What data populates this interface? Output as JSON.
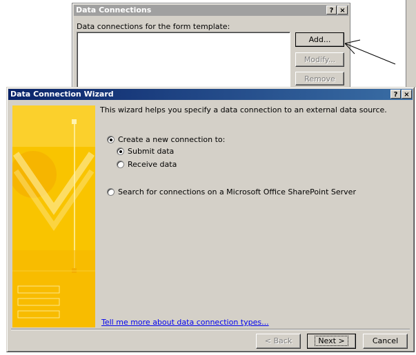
{
  "data_connections_dialog": {
    "title": "Data Connections",
    "help_button": "?",
    "close_button": "×",
    "list_label": "Data connections for the form template:",
    "buttons": {
      "add": "Add...",
      "modify": "Modify...",
      "remove": "Remove"
    }
  },
  "wizard": {
    "title": "Data Connection Wizard",
    "help_button": "?",
    "close_button": "×",
    "intro": "This wizard helps you specify a data connection to an external data source.",
    "options": {
      "create_new": "Create a new connection to:",
      "submit_data": "Submit data",
      "receive_data": "Receive data",
      "search_sharepoint": "Search for connections on a Microsoft Office SharePoint Server"
    },
    "selected": {
      "top": "create_new",
      "sub": "submit_data"
    },
    "help_link": "Tell me more about data connection types...",
    "buttons": {
      "back": "< Back",
      "next": "Next >",
      "cancel": "Cancel"
    }
  },
  "colors": {
    "banner_yellow": "#f9c400",
    "title_active": "#0a246a",
    "title_inactive": "#a0a0a0",
    "dialog_face": "#d4d0c8"
  }
}
